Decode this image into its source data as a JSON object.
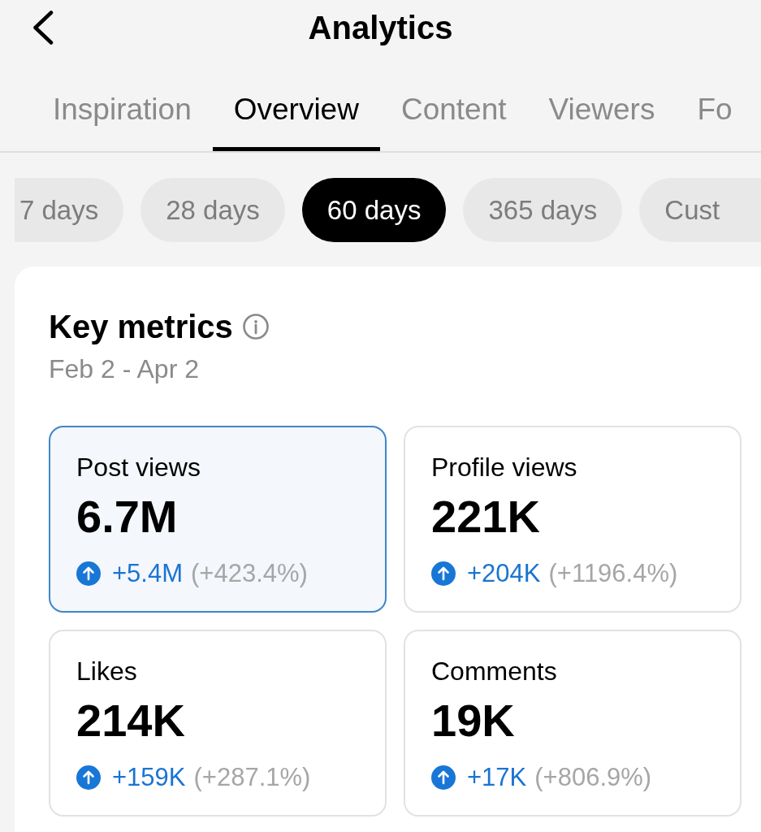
{
  "header": {
    "title": "Analytics"
  },
  "tabs": [
    {
      "label": "Inspiration",
      "selected": false
    },
    {
      "label": "Overview",
      "selected": true
    },
    {
      "label": "Content",
      "selected": false
    },
    {
      "label": "Viewers",
      "selected": false
    },
    {
      "label": "Fo",
      "selected": false
    }
  ],
  "ranges": [
    {
      "label": "7 days",
      "selected": false
    },
    {
      "label": "28 days",
      "selected": false
    },
    {
      "label": "60 days",
      "selected": true
    },
    {
      "label": "365 days",
      "selected": false
    },
    {
      "label": "Cust",
      "selected": false
    }
  ],
  "key_metrics": {
    "title": "Key metrics",
    "date_range": "Feb 2 - Apr 2",
    "metrics": [
      {
        "label": "Post views",
        "value": "6.7M",
        "kind": "increase",
        "change": "+5.4M",
        "percent": "(+423.4%)",
        "selected": true
      },
      {
        "label": "Profile views",
        "value": "221K",
        "kind": "increase",
        "change": "+204K",
        "percent": "(+1196.4%)",
        "selected": false
      },
      {
        "label": "Likes",
        "value": "214K",
        "kind": "increase",
        "change": "+159K",
        "percent": "(+287.1%)",
        "selected": false
      },
      {
        "label": "Comments",
        "value": "19K",
        "kind": "increase",
        "change": "+17K",
        "percent": "(+806.9%)",
        "selected": false
      }
    ]
  }
}
